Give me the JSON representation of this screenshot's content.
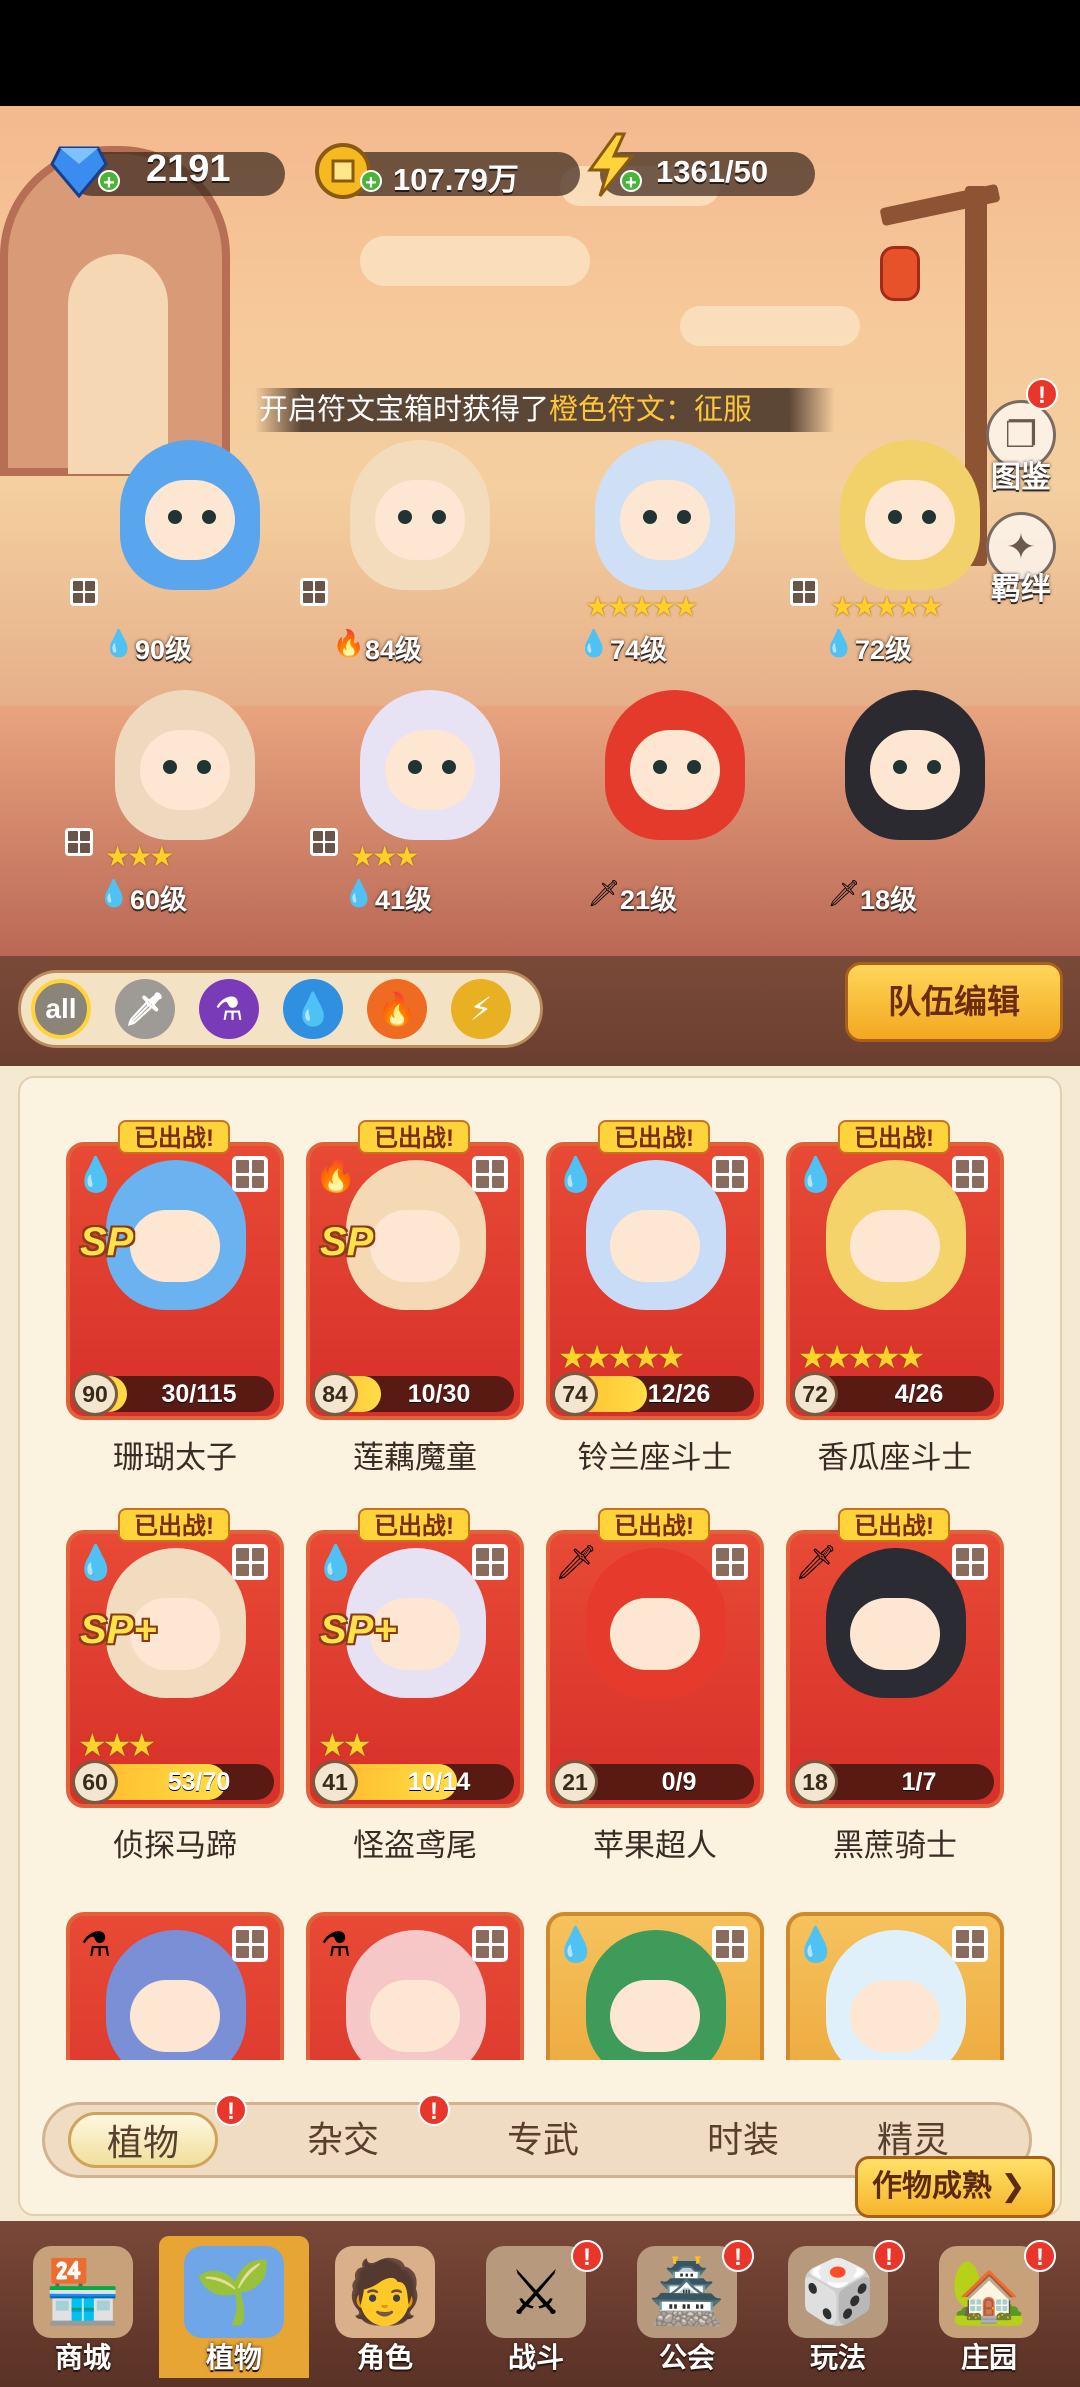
{
  "resources": {
    "gems": "2191",
    "coins": "107.79万",
    "energy": "1361/50"
  },
  "marquee": {
    "prefix": "开启符文宝箱时获得了",
    "highlight": "橙色符文：征服"
  },
  "side_buttons": {
    "encyclopedia": "图鉴",
    "bonds": "羁绊"
  },
  "team_heroes": [
    {
      "level": "90级",
      "element": "water",
      "grid": true,
      "stars": ""
    },
    {
      "level": "84级",
      "element": "fire",
      "grid": true,
      "stars": ""
    },
    {
      "level": "74级",
      "element": "water",
      "grid": false,
      "stars": "★★★★★"
    },
    {
      "level": "72级",
      "element": "water",
      "grid": true,
      "stars": "★★★★★"
    },
    {
      "level": "60级",
      "element": "water",
      "grid": true,
      "stars": "★★★"
    },
    {
      "level": "41级",
      "element": "water",
      "grid": true,
      "stars": "★★★"
    },
    {
      "level": "21级",
      "element": "sword",
      "grid": false,
      "stars": ""
    },
    {
      "level": "18级",
      "element": "sword",
      "grid": false,
      "stars": ""
    }
  ],
  "filters": {
    "all": "all",
    "team_edit": "队伍编辑"
  },
  "cards": [
    {
      "name": "珊瑚太子",
      "level": "90",
      "count": "30/115",
      "progress": 0.26,
      "banner": "已出战!",
      "sp": "SP",
      "stars": "",
      "element": "water",
      "color": "#6ab3f0"
    },
    {
      "name": "莲藕魔童",
      "level": "84",
      "count": "10/30",
      "progress": 0.33,
      "banner": "已出战!",
      "sp": "SP",
      "stars": "",
      "element": "fire",
      "color": "#f4d9b4"
    },
    {
      "name": "铃兰座斗士",
      "level": "74",
      "count": "12/26",
      "progress": 0.46,
      "banner": "已出战!",
      "sp": "",
      "stars": "★★★★★",
      "element": "water",
      "color": "#c9dcf7"
    },
    {
      "name": "香瓜座斗士",
      "level": "72",
      "count": "4/26",
      "progress": 0.15,
      "banner": "已出战!",
      "sp": "",
      "stars": "★★★★★",
      "element": "water",
      "color": "#f5d36b"
    },
    {
      "name": "侦探马蹄",
      "level": "60",
      "count": "53/70",
      "progress": 0.76,
      "banner": "已出战!",
      "sp": "SP+",
      "stars": "★★★",
      "element": "water",
      "color": "#f2dcc0"
    },
    {
      "name": "怪盗鸢尾",
      "level": "41",
      "count": "10/14",
      "progress": 0.71,
      "banner": "已出战!",
      "sp": "SP+",
      "stars": "★★",
      "element": "water",
      "color": "#e6e2f4"
    },
    {
      "name": "苹果超人",
      "level": "21",
      "count": "0/9",
      "progress": 0.0,
      "banner": "已出战!",
      "sp": "",
      "stars": "",
      "element": "sword",
      "color": "#e63b2c"
    },
    {
      "name": "黑蔗骑士",
      "level": "18",
      "count": "1/7",
      "progress": 0.14,
      "banner": "已出战!",
      "sp": "",
      "stars": "",
      "element": "sword",
      "color": "#2b2b33"
    },
    {
      "name": "",
      "level": "",
      "count": "",
      "progress": 0,
      "banner": "",
      "sp": "",
      "stars": "",
      "element": "poison",
      "color": "#7b8fd6"
    },
    {
      "name": "",
      "level": "",
      "count": "",
      "progress": 0,
      "banner": "",
      "sp": "",
      "stars": "",
      "element": "poison",
      "color": "#f6c7c7"
    },
    {
      "name": "",
      "level": "",
      "count": "",
      "progress": 0,
      "banner": "",
      "sp": "",
      "stars": "",
      "element": "water",
      "color": "#3e9b5a"
    },
    {
      "name": "",
      "level": "",
      "count": "",
      "progress": 0,
      "banner": "",
      "sp": "",
      "stars": "",
      "element": "water",
      "color": "#dff0fb"
    }
  ],
  "tabs": [
    "植物",
    "杂交",
    "专武",
    "时装",
    "精灵"
  ],
  "crop_button": "作物成熟 ❯",
  "nav": [
    {
      "label": "商城",
      "icon": "🏪"
    },
    {
      "label": "植物",
      "icon": "🌱"
    },
    {
      "label": "角色",
      "icon": "🧑"
    },
    {
      "label": "战斗",
      "icon": "⚔"
    },
    {
      "label": "公会",
      "icon": "🏯"
    },
    {
      "label": "玩法",
      "icon": "🎲"
    },
    {
      "label": "庄园",
      "icon": "🏡"
    }
  ],
  "colors": {
    "accent_gold": "#ffd43b",
    "card_red": "#e84a35",
    "notif_red": "#e8362b"
  }
}
